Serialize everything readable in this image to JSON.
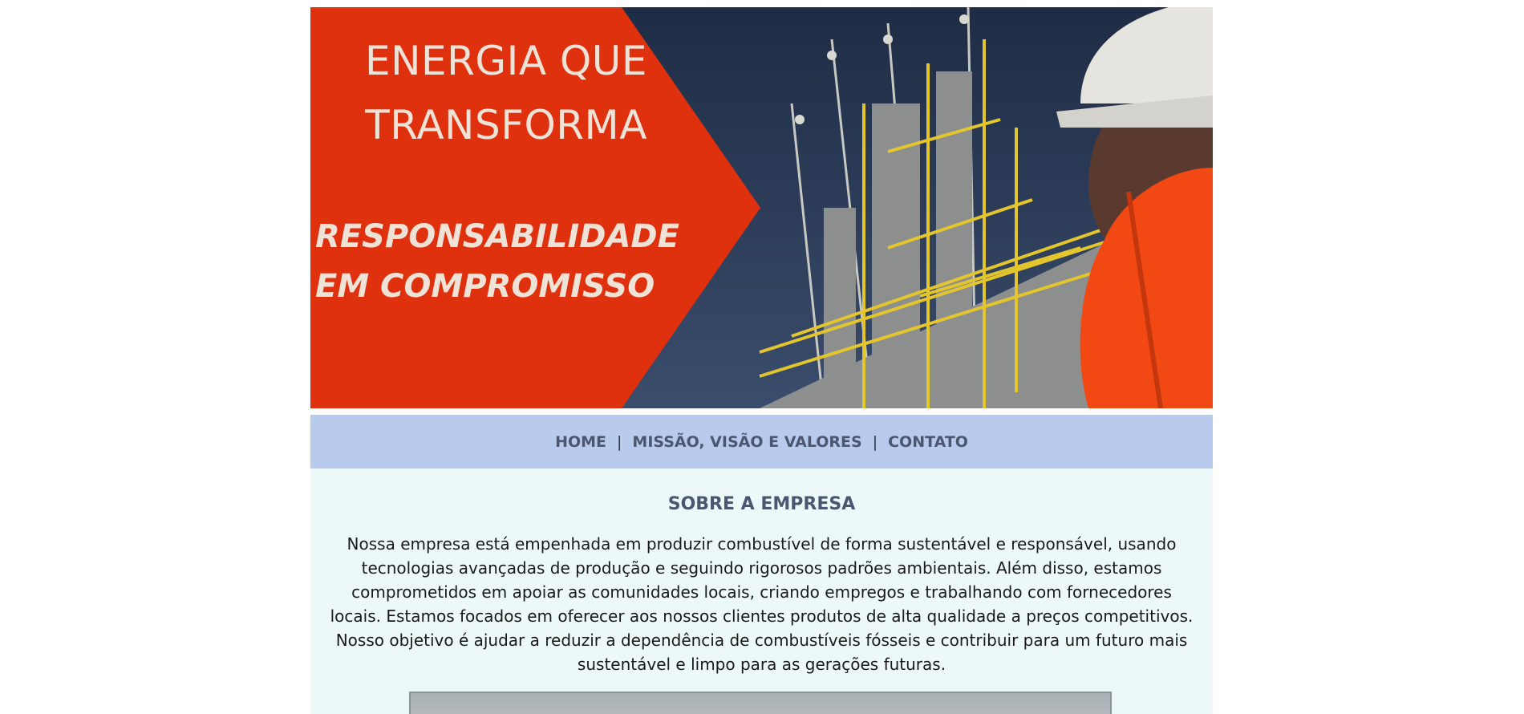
{
  "hero": {
    "headline": "ENERGIA QUE TRANSFORMA",
    "tagline_line1": "RESPONSABILIDADE",
    "tagline_line2": "EM COMPROMISSO",
    "accent_color": "#e0310f"
  },
  "nav": {
    "items": [
      {
        "label": "HOME"
      },
      {
        "label": "MISSÃO, VISÃO E VALORES"
      },
      {
        "label": "CONTATO"
      }
    ],
    "separator": "|"
  },
  "about": {
    "title": "SOBRE A EMPRESA",
    "text": "Nossa empresa está empenhada em produzir combustível de forma sustentável e responsável, usando tecnologias avançadas de produção e seguindo rigorosos padrões ambientais. Além disso, estamos comprometidos em apoiar as comunidades locais, criando empregos e trabalhando com fornecedores locais. Estamos focados em oferecer aos nossos clientes produtos de alta qualidade a preços competitivos. Nosso objetivo é ajudar a reduzir a dependência de combustíveis fósseis e contribuir para um futuro mais sustentável e limpo para as gerações futuras."
  }
}
